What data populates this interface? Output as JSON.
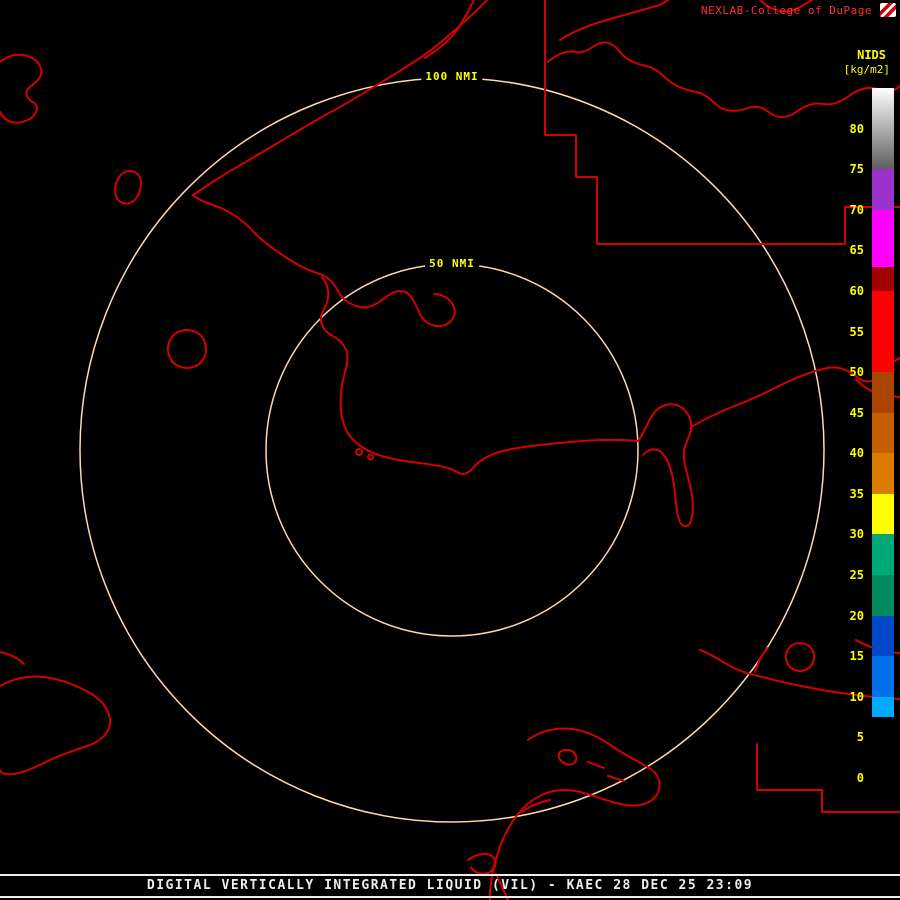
{
  "header": {
    "title": "NEXLAB-College of DuPage",
    "logo_icon": "dupage-flag-logo"
  },
  "colorbar": {
    "title": "NIDS",
    "units": "[kg/m2]",
    "min": 0,
    "max": 85,
    "ticks": [
      80,
      75,
      70,
      65,
      60,
      55,
      50,
      45,
      40,
      35,
      30,
      25,
      20,
      15,
      10,
      5,
      0
    ],
    "segments": [
      {
        "from": 75,
        "to": 85,
        "color_top": "#ffffff",
        "color_bottom": "#5e5e5e"
      },
      {
        "from": 70,
        "to": 75,
        "color": "#9933cc"
      },
      {
        "from": 63,
        "to": 70,
        "color": "#ff00ff"
      },
      {
        "from": 60,
        "to": 63,
        "color": "#a00000"
      },
      {
        "from": 50,
        "to": 60,
        "color": "#ff0000"
      },
      {
        "from": 45,
        "to": 50,
        "color": "#aa4400"
      },
      {
        "from": 40,
        "to": 45,
        "color": "#c45f00"
      },
      {
        "from": 35,
        "to": 40,
        "color": "#d97c00"
      },
      {
        "from": 30,
        "to": 35,
        "color": "#ffff00"
      },
      {
        "from": 25,
        "to": 30,
        "color": "#00a878"
      },
      {
        "from": 20,
        "to": 25,
        "color": "#008a5e"
      },
      {
        "from": 15,
        "to": 20,
        "color": "#0048c8"
      },
      {
        "from": 10,
        "to": 15,
        "color": "#0070e8"
      },
      {
        "from": 7.5,
        "to": 10,
        "color": "#00aaff"
      },
      {
        "from": 0,
        "to": 7.5,
        "color": "#000000"
      }
    ]
  },
  "range_rings": {
    "outer_label": "100 NMI",
    "inner_label": "50 NMI"
  },
  "footer": {
    "caption": "DIGITAL VERTICALLY INTEGRATED LIQUID (VIL) - KAEC 28 DEC 25 23:09"
  },
  "colors": {
    "map_outline": "#d40000",
    "ring": "#ffd9b0",
    "label_yellow": "#ffff00",
    "header_red": "#ff3030",
    "caption_white": "#ededed"
  }
}
